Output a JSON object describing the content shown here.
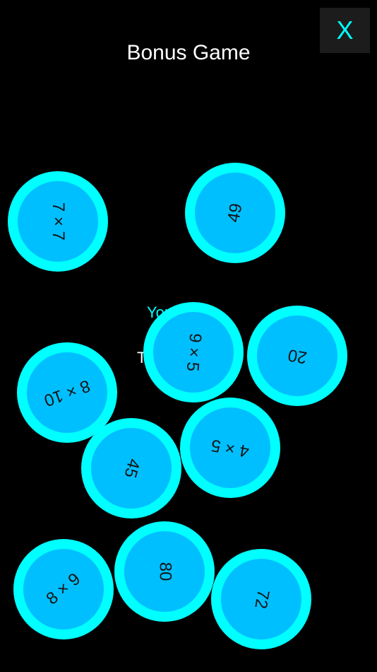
{
  "header": {
    "title": "Bonus Game",
    "close_label": "X"
  },
  "status": {
    "line1": "You … ll!",
    "line2": "T"
  },
  "colors": {
    "background": "#000000",
    "coin_ring": "#00ffff",
    "coin_fill": "#00bfff",
    "accent": "#00ffff"
  },
  "coins": [
    {
      "label": "7 × 7"
    },
    {
      "label": "49"
    },
    {
      "label": "9 × 5"
    },
    {
      "label": "20"
    },
    {
      "label": "8 × 10"
    },
    {
      "label": "4 × 5"
    },
    {
      "label": "45"
    },
    {
      "label": "8 × 9"
    },
    {
      "label": "80"
    },
    {
      "label": "72"
    }
  ]
}
